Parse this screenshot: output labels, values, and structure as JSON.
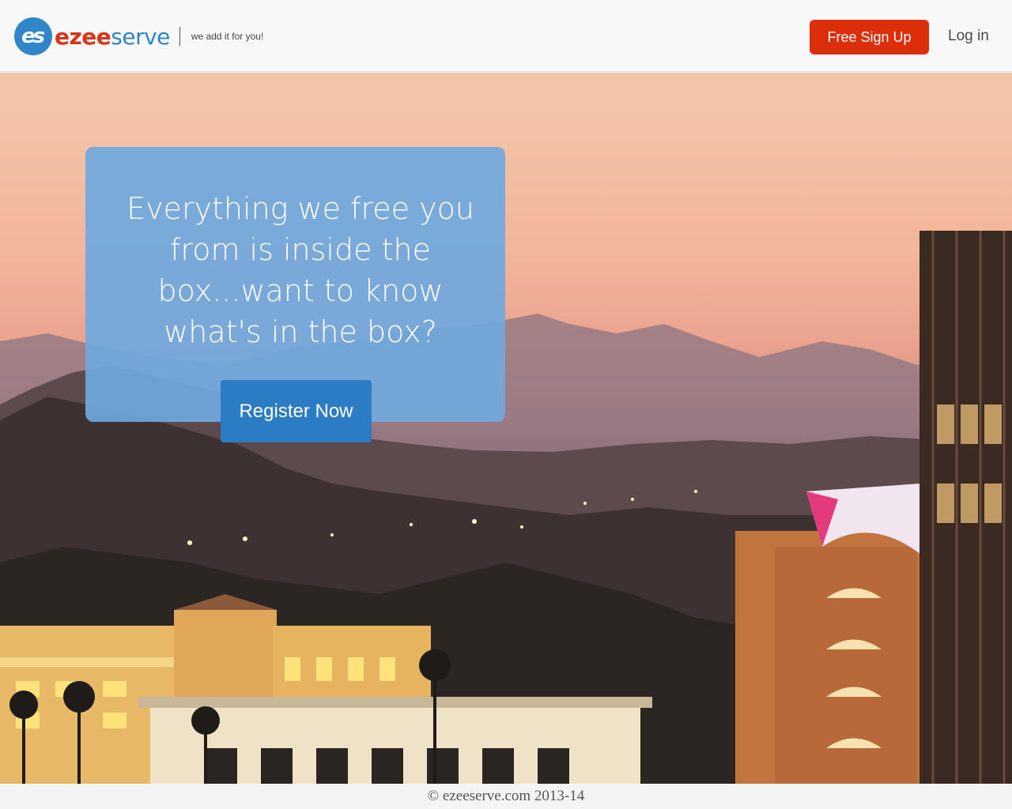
{
  "header": {
    "logo_badge": "es",
    "logo_word_part1": "ezee",
    "logo_word_part2": "serve",
    "tagline": "we add it for you!",
    "signup_label": "Free Sign Up",
    "login_label": "Log in"
  },
  "hero": {
    "headline_lines": [
      "Everything we free you",
      "from is inside the",
      "box...want to know",
      "what's in the box?"
    ],
    "register_label": "Register Now"
  },
  "footer": {
    "copyright": "© ezeeserve.com 2013-14"
  },
  "colors": {
    "brand_blue": "#2f86c9",
    "brand_red": "#dd2e0b",
    "promo_box": "#70a8de",
    "register_button": "#2b7cc2"
  }
}
